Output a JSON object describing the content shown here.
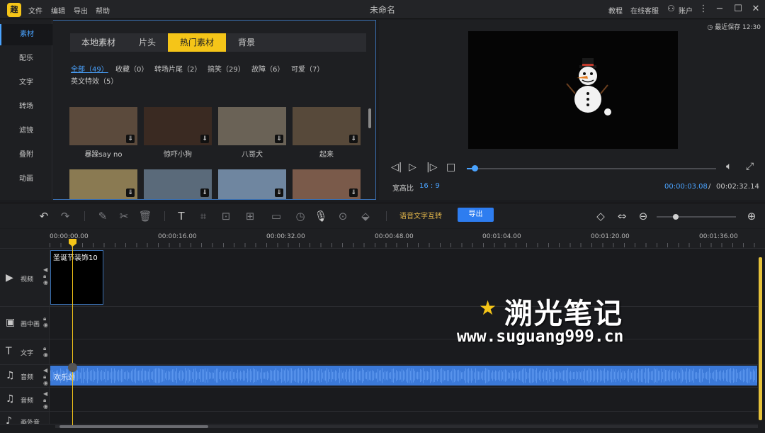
{
  "titlebar": {
    "logo": "趣",
    "menu": [
      "文件",
      "编辑",
      "导出",
      "帮助"
    ],
    "title": "未命名",
    "tutorial": "教程",
    "support": "在线客服",
    "account": "账户"
  },
  "sidenav": [
    "素材",
    "配乐",
    "文字",
    "转场",
    "滤镜",
    "叠附",
    "动画"
  ],
  "media": {
    "tabs": [
      "本地素材",
      "片头",
      "热门素材",
      "背景"
    ],
    "categories": [
      "全部（49）",
      "收藏（0）",
      "转场片尾（2）",
      "搞笑（29）",
      "故障（6）",
      "可爱（7）",
      "英文特效（5）"
    ],
    "thumbs": [
      {
        "label": "暴躁say no",
        "color": "#5b4a3c"
      },
      {
        "label": "惊吓小狗",
        "color": "#3a2a22"
      },
      {
        "label": "八哥犬",
        "color": "#6a6256"
      },
      {
        "label": "起来",
        "color": "#57493a"
      },
      {
        "label": "",
        "color": "#8a7a52"
      },
      {
        "label": "",
        "color": "#5a6a7a"
      },
      {
        "label": "",
        "color": "#6f86a0"
      },
      {
        "label": "",
        "color": "#7a5a4a"
      }
    ]
  },
  "preview": {
    "save_status": "最近保存 12:30",
    "ratio_label": "宽高比",
    "ratio_value": "16 : 9",
    "time_current": "00:00:03.08",
    "time_sep": "/",
    "time_total": "00:02:32.14",
    "progress": 0.03
  },
  "toolbar": {
    "speech_label": "语音文字互转",
    "export_label": "导出",
    "zoom_level": 0.24
  },
  "timeline": {
    "ticks": [
      "00:00:00.00",
      "00:00:16.00",
      "00:00:32.00",
      "00:00:48.00",
      "00:01:04.00",
      "00:01:20.00",
      "00:01:36.00"
    ],
    "tracks": [
      {
        "name": "视频",
        "icon": "▶"
      },
      {
        "name": "画中画",
        "icon": "▣"
      },
      {
        "name": "文字",
        "icon": "T"
      },
      {
        "name": "音频",
        "icon": "♫"
      },
      {
        "name": "音频",
        "icon": "♫"
      },
      {
        "name": "画外音",
        "icon": "♪"
      }
    ],
    "clip_label": "圣诞节装饰10",
    "audio_label": "欢乐颂"
  },
  "watermark": {
    "title": "溯光笔记",
    "url": "www.suguang999.cn"
  }
}
